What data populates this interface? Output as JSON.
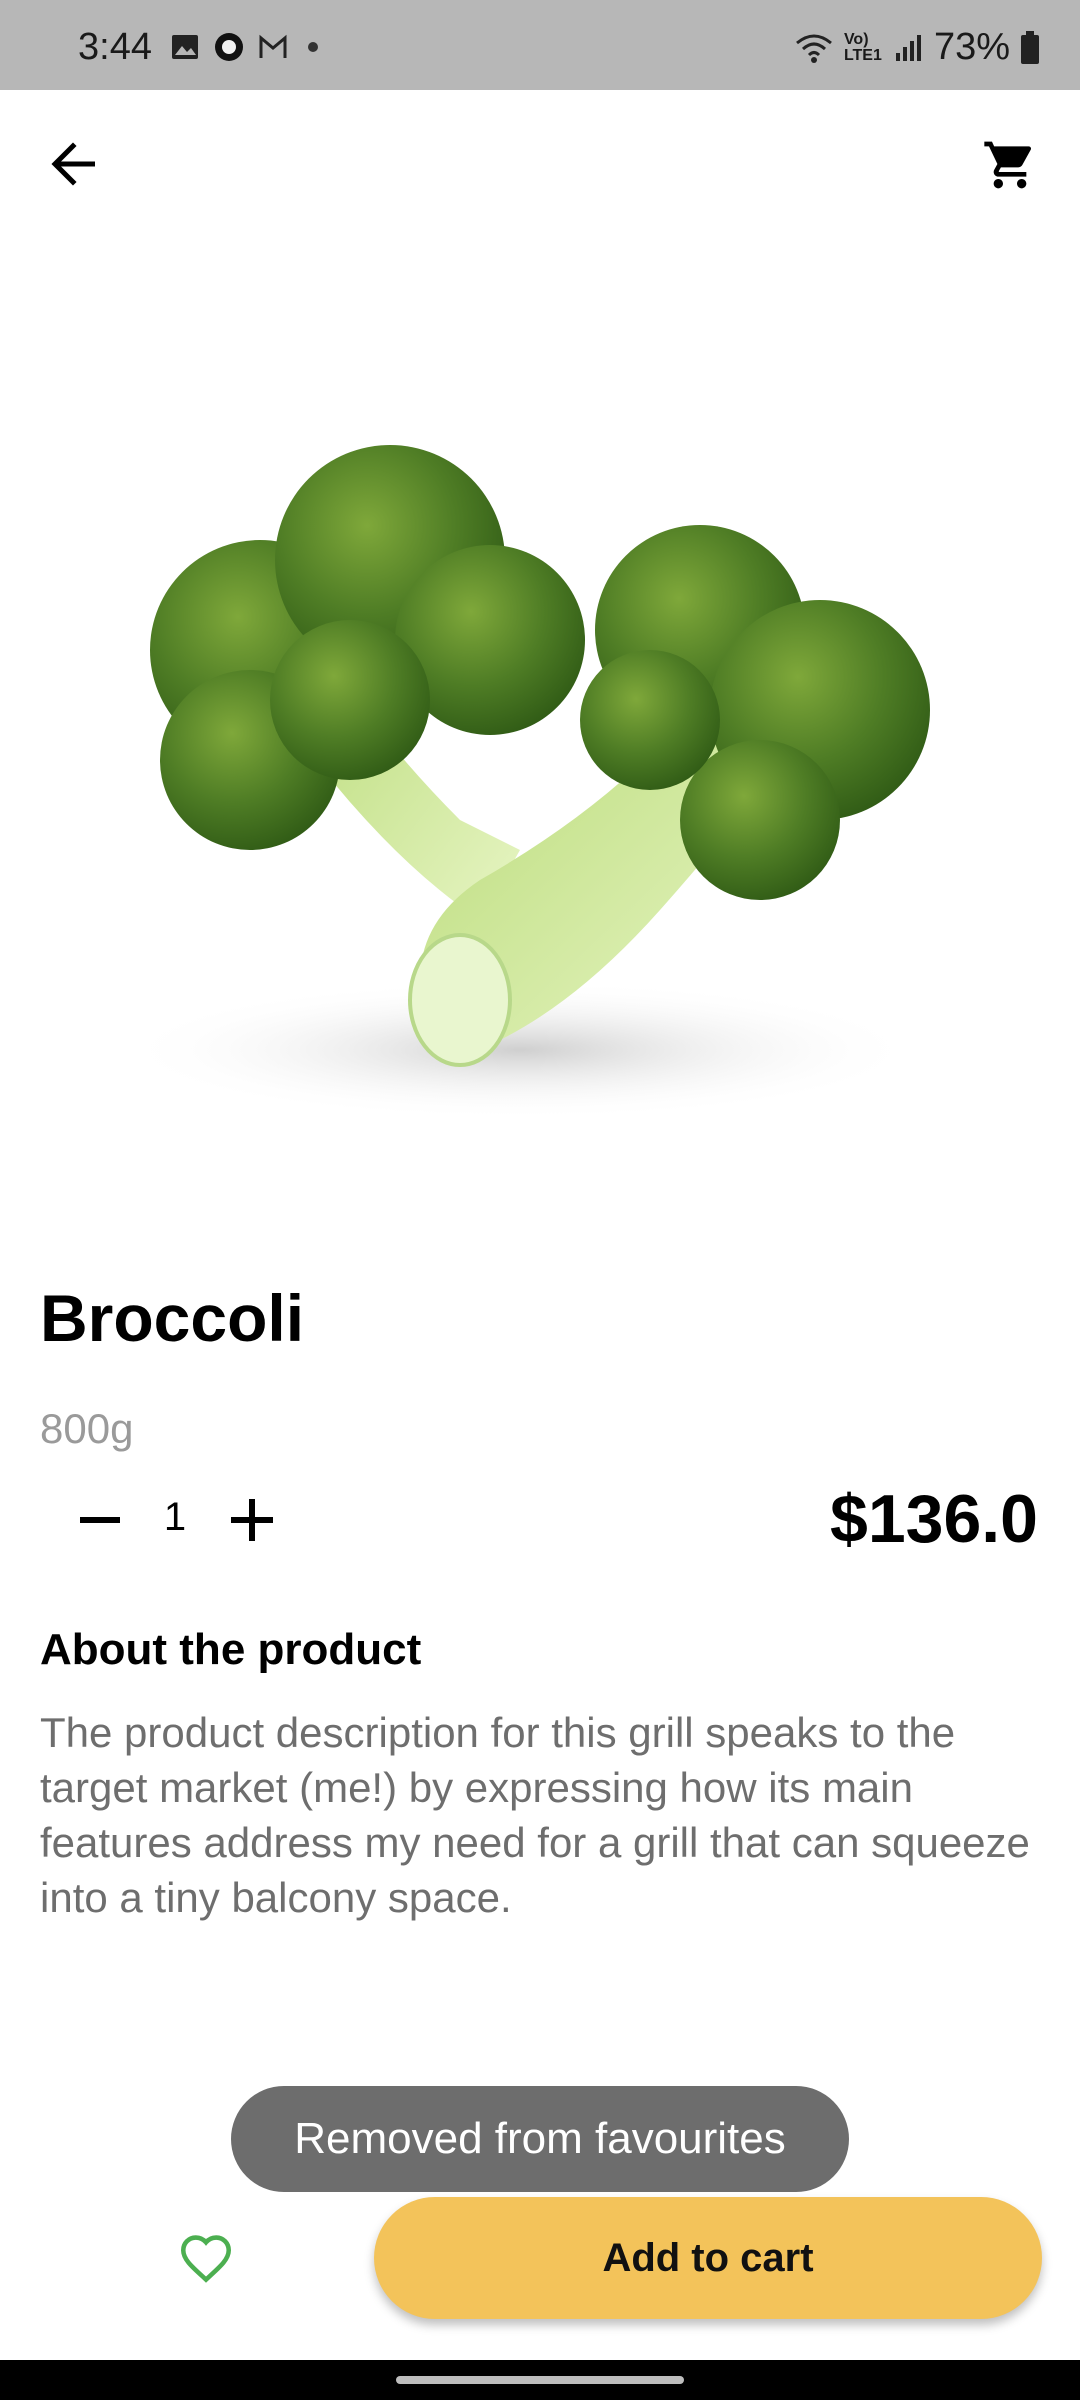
{
  "status_bar": {
    "time": "3:44",
    "network_label": "Vo) LTE1",
    "battery": "73%"
  },
  "header": {
    "back_icon": "arrow-left-icon",
    "cart_icon": "shopping-cart-icon"
  },
  "product": {
    "image_icon": "broccoli-image",
    "name": "Broccoli",
    "weight": "800g",
    "quantity": "1",
    "price": "$136.0",
    "about_heading": "About the product",
    "description": "The product description for this grill speaks to the target market (me!) by expressing how its main features address my need for a grill that can squeeze into a tiny balcony space."
  },
  "toast": {
    "message": "Removed from favourites"
  },
  "actions": {
    "favourite_icon": "heart-outline-icon",
    "add_to_cart_label": "Add to cart"
  },
  "colors": {
    "accent_yellow": "#f3c35a",
    "heart_green": "#4caf50",
    "toast_bg": "#6d6d6d",
    "status_bar_bg": "#b7b7b7"
  }
}
